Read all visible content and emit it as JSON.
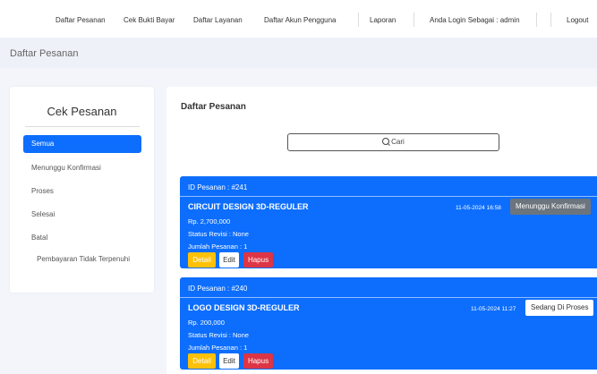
{
  "nav": {
    "items": [
      "Daftar Pesanan",
      "Cek Bukti Bayar",
      "Daftar Layanan",
      "Daftar Akun Pengguna"
    ],
    "laporan": "Laporan",
    "login": "Anda Login Sebagai : admin",
    "logout": "Logout"
  },
  "page": {
    "title": "Daftar Pesanan"
  },
  "sidebar": {
    "title": "Cek Pesanan",
    "items": [
      "Semua",
      "Menunggu Konfirmasi",
      "Proses",
      "Selesai",
      "Batal",
      "Pembayaran Tidak Terpenuhi"
    ]
  },
  "main": {
    "title": "Daftar Pesanan"
  },
  "search": {
    "label": "Cari"
  },
  "orders": [
    {
      "id": "ID Pesanan : #241",
      "title": "CIRCUIT DESIGN 3D-REGULER",
      "price": "Rp. 2,700,000",
      "revision": "Status Revisi : None",
      "quantity": "Jumlah Pesanan : 1",
      "date": "11-05-2024 16:58",
      "status": "Menunggu Konfirmasi"
    },
    {
      "id": "ID Pesanan : #240",
      "title": "LOGO DESIGN 3D-REGULER",
      "price": "Rp. 200,000",
      "revision": "Status Revisi : None",
      "quantity": "Jumlah Pesanan : 1",
      "date": "11-05-2024 11:27",
      "status": "Sedang Di Proses"
    }
  ],
  "buttons": {
    "detail": "Detail",
    "edit": "Edit",
    "hapus": "Hapus"
  },
  "colors": {
    "primary": "#0d6efd",
    "warning": "#ffc107",
    "danger": "#dc3545",
    "secondary": "#6c757d"
  },
  "icons": {
    "search": "search-icon"
  }
}
